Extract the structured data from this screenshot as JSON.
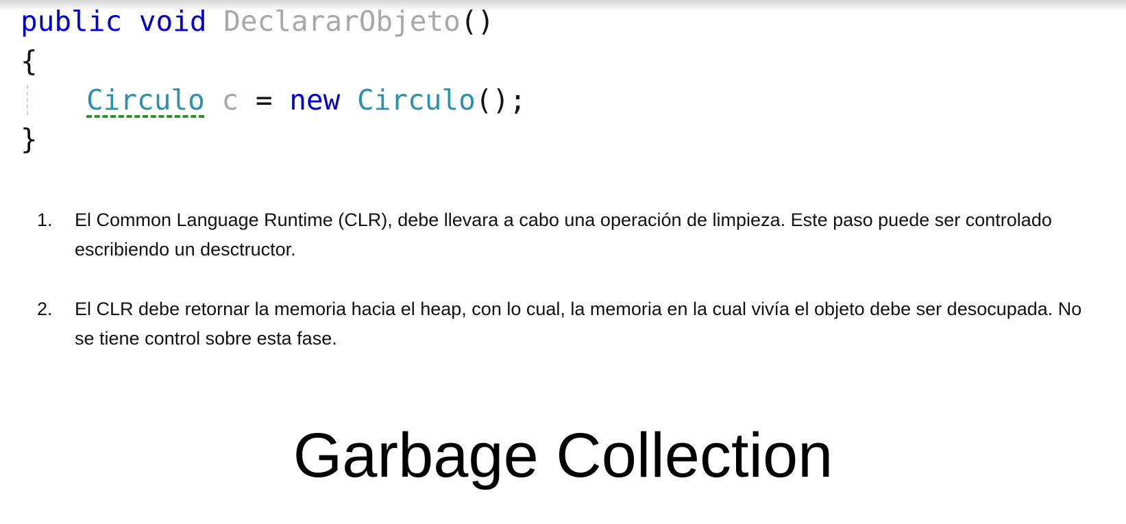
{
  "code": {
    "line1": {
      "kw_public": "public",
      "kw_void": "void",
      "method_name": "DeclararObjeto",
      "parens": "()"
    },
    "line2": {
      "brace_open": "{"
    },
    "line3": {
      "type_circulo": "Circulo",
      "var_c": "c",
      "op_assign": "=",
      "kw_new": "new",
      "type_circulo_ctor": "Circulo",
      "ctor_call": "();"
    },
    "line4": {
      "brace_close": "}"
    }
  },
  "list": {
    "items": [
      {
        "number": "1.",
        "text": "El Common Language Runtime (CLR), debe llevara a cabo una operación de limpieza. Este paso puede ser controlado escribiendo un desctructor."
      },
      {
        "number": "2.",
        "text": "El CLR debe retornar la memoria hacia el heap, con lo cual, la memoria en la cual vivía el objeto debe ser desocupada. No se tiene control sobre esta fase."
      }
    ]
  },
  "title": "Garbage Collection",
  "colors": {
    "keyword": "#0000d6",
    "type": "#2b91af",
    "identifier_gray": "#a8a8a8",
    "squiggle": "#2f8f2f"
  }
}
